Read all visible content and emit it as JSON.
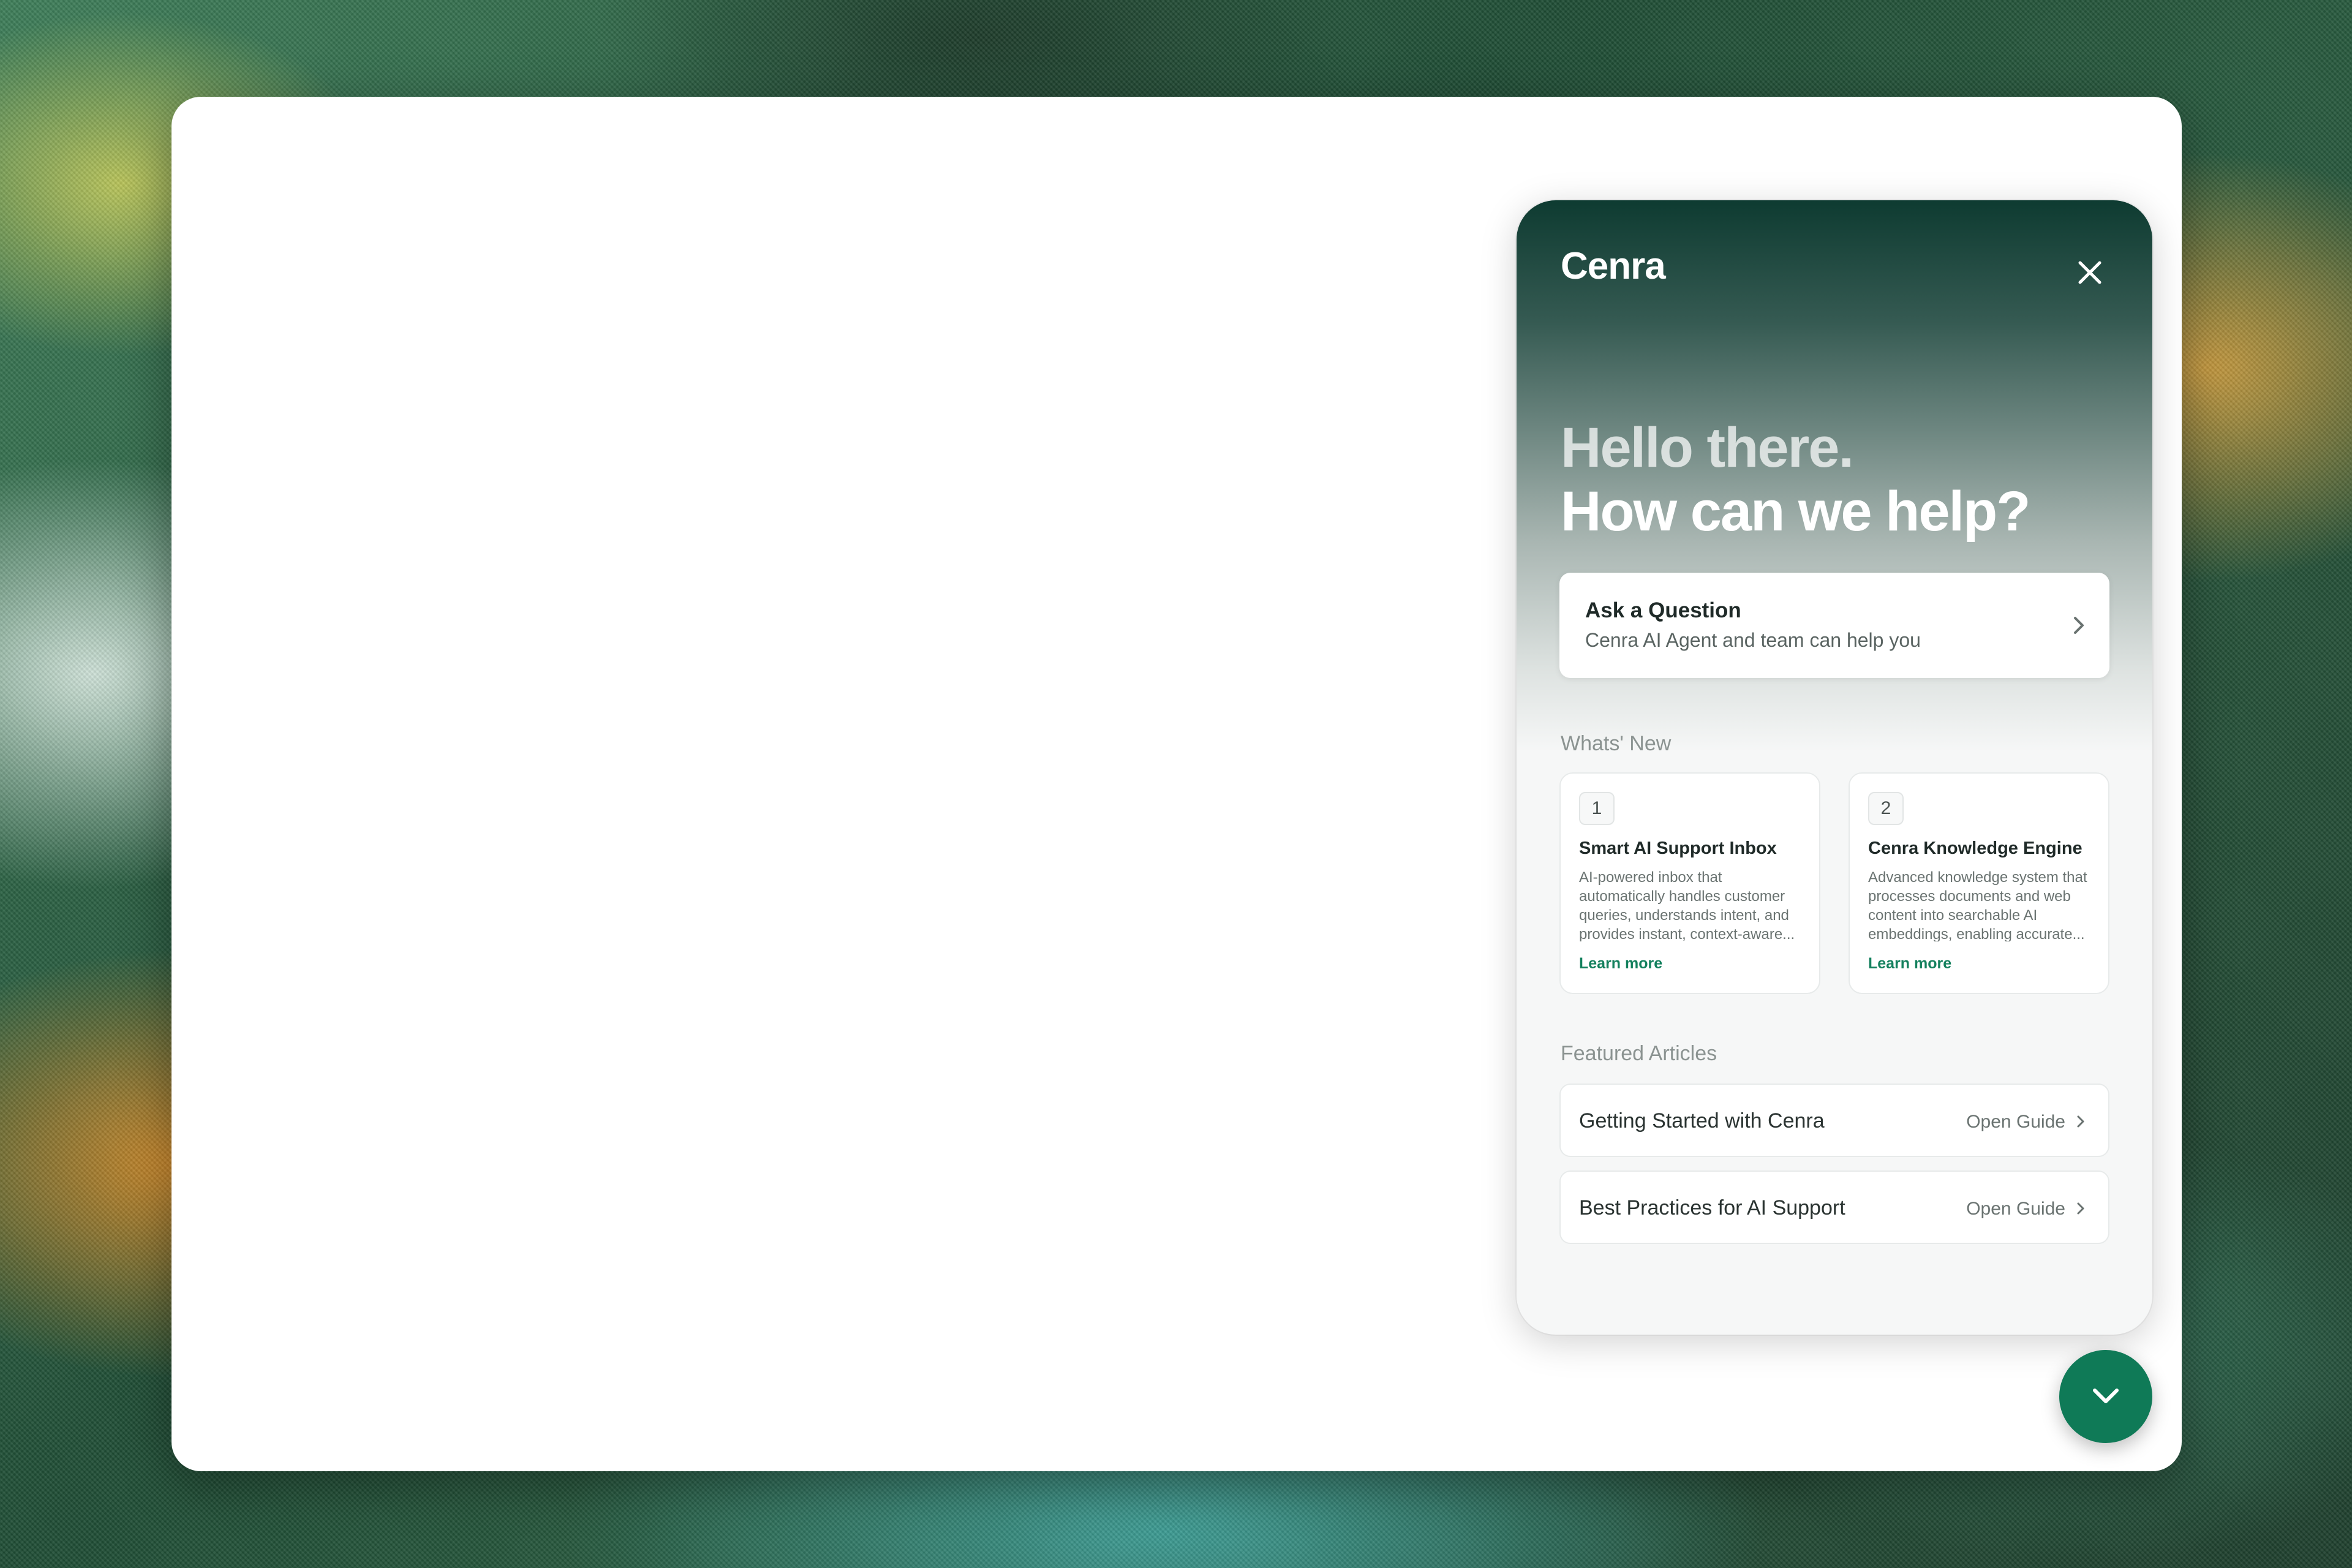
{
  "widget": {
    "brand": "Cenra",
    "greeting_line1": "Hello there.",
    "greeting_line2": "How can we help?",
    "ask": {
      "title": "Ask a Question",
      "subtitle": "Cenra AI Agent and team can help you"
    },
    "whats_new": {
      "label": "Whats' New",
      "items": [
        {
          "number": "1",
          "title": "Smart AI Support Inbox",
          "description": "AI-powered inbox that automatically handles customer queries, understands intent, and provides instant, context-aware...",
          "link": "Learn more"
        },
        {
          "number": "2",
          "title": "Cenra Knowledge Engine",
          "description": "Advanced knowledge system that processes documents and web content into searchable AI embeddings, enabling accurate...",
          "link": "Learn more"
        }
      ]
    },
    "featured": {
      "label": "Featured Articles",
      "items": [
        {
          "title": "Getting Started with Cenra",
          "action": "Open Guide"
        },
        {
          "title": "Best Practices for AI Support",
          "action": "Open Guide"
        }
      ]
    }
  },
  "colors": {
    "accent": "#0f7a57",
    "link": "#13805d",
    "hero_top": "#0e3b31"
  },
  "icons": {
    "close": "close-icon",
    "chevron_right": "chevron-right-icon",
    "chevron_down": "chevron-down-icon"
  }
}
